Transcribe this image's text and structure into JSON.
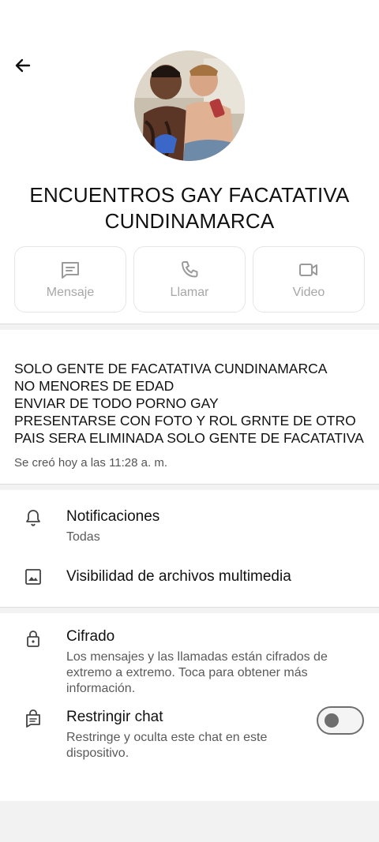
{
  "header": {
    "back_icon": "arrow-left-icon",
    "group_name_line1": "ENCUENTROS GAY FACATATIVA",
    "group_name_line2": "CUNDINAMARCA"
  },
  "actions": [
    {
      "label": "Mensaje",
      "icon": "message-icon"
    },
    {
      "label": "Llamar",
      "icon": "phone-icon"
    },
    {
      "label": "Video",
      "icon": "video-icon"
    }
  ],
  "description": {
    "lines": [
      "SOLO GENTE DE FACATATIVA CUNDINAMARCA",
      "NO MENORES DE EDAD",
      "ENVIAR DE TODO PORNO GAY",
      "PRESENTARSE CON FOTO Y ROL GRNTE DE OTRO",
      "PAIS SERA ELIMINADA SOLO GENTE DE FACATATIVA"
    ],
    "created": "Se creó hoy a las 11:28 a. m."
  },
  "settings": {
    "notifications": {
      "title": "Notificaciones",
      "value": "Todas",
      "icon": "bell-icon"
    },
    "media_visibility": {
      "title": "Visibilidad de archivos multimedia",
      "icon": "image-icon"
    },
    "encryption": {
      "title": "Cifrado",
      "subtitle": "Los mensajes y las llamadas están cifrados de extremo a extremo. Toca para obtener más información.",
      "icon": "lock-icon"
    },
    "restrict_chat": {
      "title": "Restringir chat",
      "subtitle": "Restringe y oculta este chat en este dispositivo.",
      "icon": "chat-lock-icon",
      "enabled": false
    }
  },
  "colors": {
    "background": "#f2f2f2",
    "card": "#ffffff",
    "muted_label": "#a7a7a7",
    "toggle_off": "#6e6e6e"
  }
}
